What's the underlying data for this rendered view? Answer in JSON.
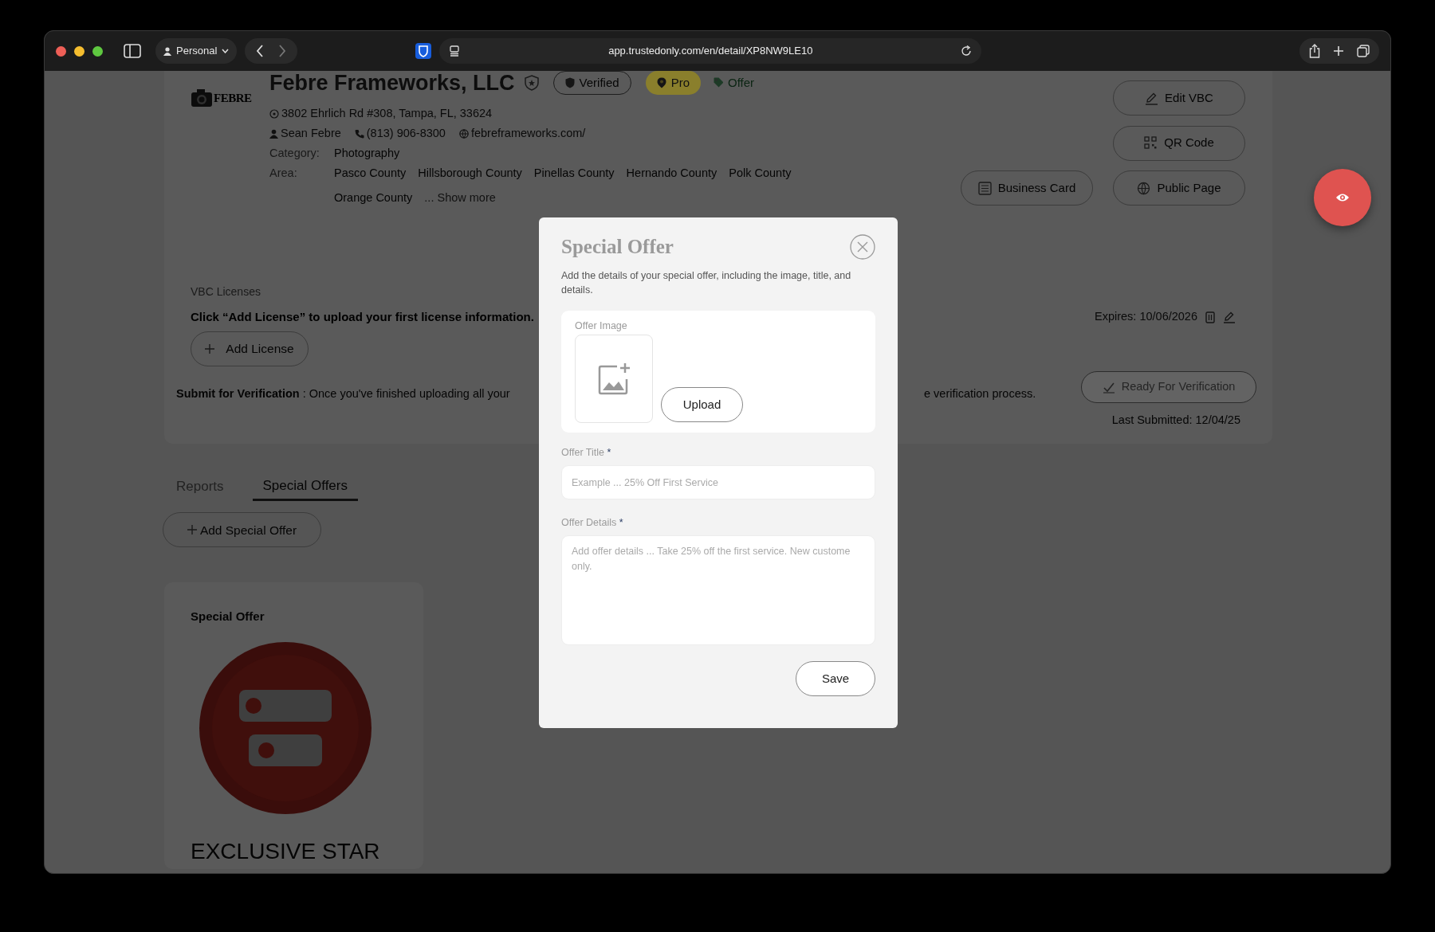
{
  "browser": {
    "profile": "Personal",
    "url": "app.trustedonly.com/en/detail/XP8NW9LE10"
  },
  "business": {
    "logo_text": "FEBRE",
    "name": "Febre Frameworks, LLC",
    "badges": [
      {
        "kind": "verified",
        "label": "Verified"
      },
      {
        "kind": "pro",
        "label": "Pro"
      },
      {
        "kind": "offer",
        "label": "Offer"
      }
    ],
    "address": "3802 Ehrlich Rd #308, Tampa, FL, 33624",
    "contact": "Sean Febre",
    "phone": "(813) 906-8300",
    "website": "febreframeworks.com/",
    "category_label": "Category:",
    "category": "Photography",
    "area_label": "Area:",
    "areas": [
      "Pasco County",
      "Hillsborough County",
      "Pinellas County",
      "Hernando County",
      "Polk County",
      "Orange County"
    ],
    "show_more": "... Show more"
  },
  "actions": [
    {
      "kind": "edit",
      "label": "Edit VBC"
    },
    {
      "kind": "qr",
      "label": "QR Code"
    },
    {
      "kind": "card",
      "label": "Business Card"
    },
    {
      "kind": "globe",
      "label": "Public Page"
    }
  ],
  "licenses": {
    "heading": "VBC Licenses",
    "empty_message": "Click “Add License” to upload your first license information.",
    "add_button": "Add License",
    "expires": "Expires: 10/06/2026"
  },
  "verification": {
    "text_left": "**Submit for Verification** : Once you've finished uploading all your",
    "text_right": "e verification process.",
    "button": "Ready For Verification",
    "disabled": true,
    "last_submitted": "Last Submitted: 12/04/25"
  },
  "tabs": [
    {
      "label": "Reports",
      "selected": false
    },
    {
      "label": "Special Offers",
      "selected": true
    }
  ],
  "add_offer_button": "Add Special Offer",
  "offers": [
    {
      "heading": "Special Offer",
      "title": "EXCLUSIVE STAR"
    }
  ],
  "modal": {
    "title": "Special Offer",
    "description": "Add the details of your special offer, including the image, title, and details.",
    "image_label": "Offer Image",
    "upload_button": "Upload",
    "fields": [
      {
        "kind": "input",
        "label": "Offer Title",
        "required_mark": "*",
        "placeholder": "Example ... 25% Off First Service"
      },
      {
        "kind": "textarea",
        "label": "Offer Details",
        "required_mark": "*",
        "placeholder": "Add offer details ... Take 25% off the first service. New custome\nonly."
      }
    ],
    "save_button": "Save"
  }
}
